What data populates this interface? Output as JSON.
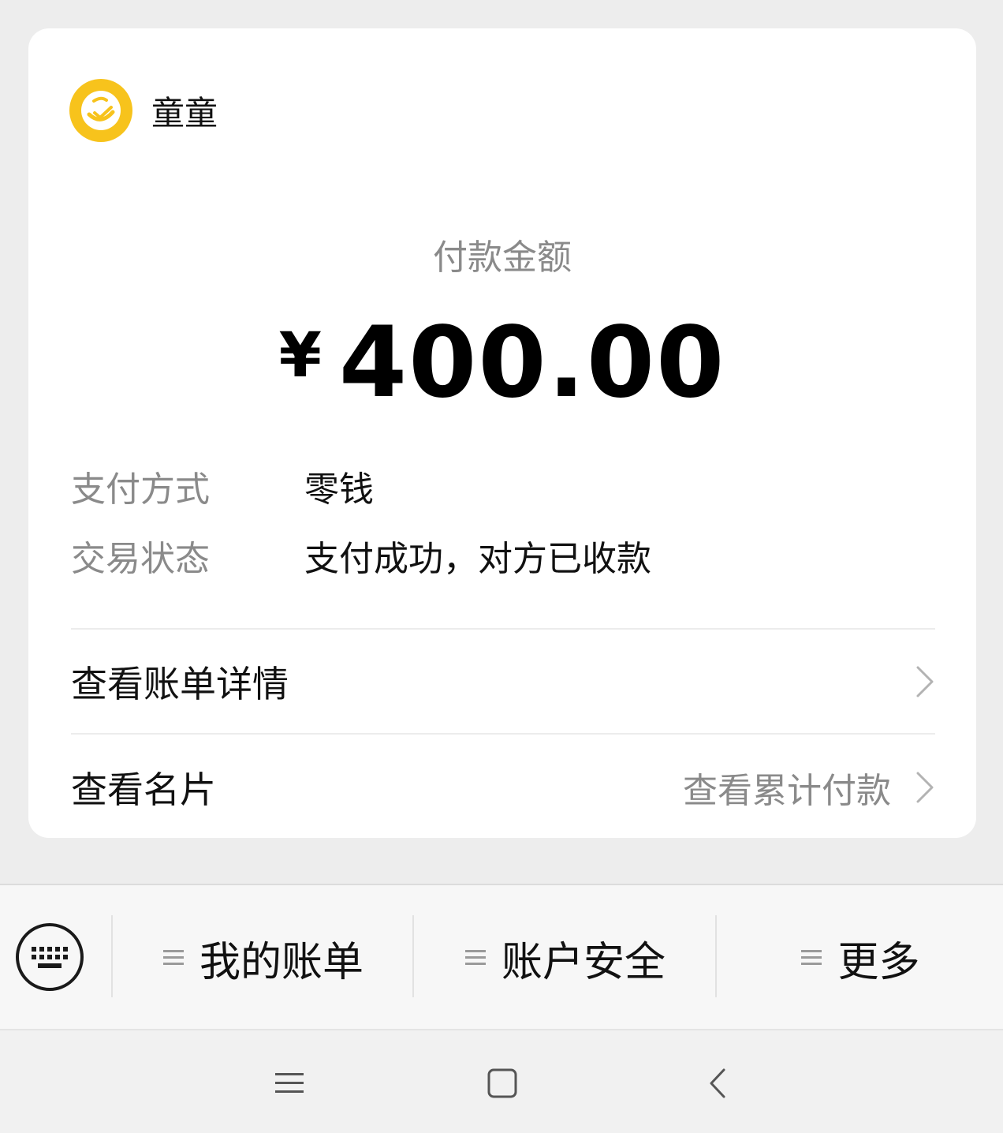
{
  "merchant": {
    "name": "童童",
    "avatar_icon": "smile-face-icon",
    "avatar_color": "#f7c31c"
  },
  "payment": {
    "amount_label": "付款金额",
    "currency": "¥",
    "amount": "400.00"
  },
  "details": [
    {
      "key": "支付方式",
      "value": "零钱"
    },
    {
      "key": "交易状态",
      "value": "支付成功，对方已收款"
    }
  ],
  "links": {
    "bill_details": "查看账单详情",
    "card": "查看名片",
    "cumulative": "查看累计付款"
  },
  "bottom_menu": [
    {
      "label": "我的账单"
    },
    {
      "label": "账户安全"
    },
    {
      "label": "更多"
    }
  ],
  "icons": {
    "keyboard": "keyboard-icon",
    "menu": "menu-lines-icon",
    "chevron": "chevron-right-icon",
    "nav_recent": "nav-menu-icon",
    "nav_home": "nav-home-icon",
    "nav_back": "nav-back-icon"
  }
}
